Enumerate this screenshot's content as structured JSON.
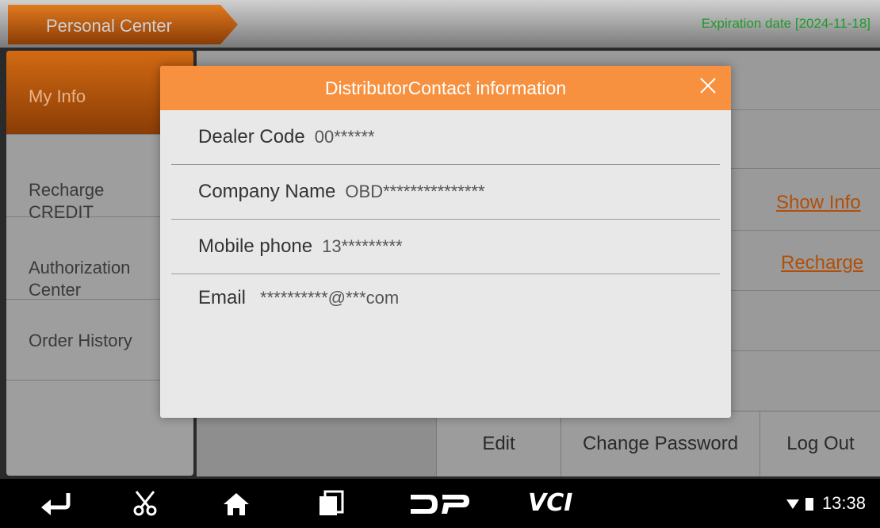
{
  "header": {
    "title": "Personal Center",
    "expiration": "Expiration date [2024-11-18]"
  },
  "sidebar": {
    "items": [
      {
        "label": "My Info",
        "active": true
      },
      {
        "label": "Recharge\nCREDIT"
      },
      {
        "label": "Authorization\nCenter"
      },
      {
        "label": "Order History"
      }
    ]
  },
  "main": {
    "show_info_link": "Show Info",
    "recharge_link": "Recharge",
    "buttons": {
      "edit": "Edit",
      "change_password": "Change Password",
      "log_out": "Log Out"
    }
  },
  "dialog": {
    "title": "DistributorContact information",
    "rows": [
      {
        "label": "Dealer Code",
        "value": "00******"
      },
      {
        "label": "Company Name",
        "value": "OBD***************"
      },
      {
        "label": "Mobile phone",
        "value": "13*********"
      },
      {
        "label": "Email",
        "value": "**********@***com"
      }
    ]
  },
  "navbar": {
    "icons": [
      "back-icon",
      "screenshot-scissors-icon",
      "home-icon",
      "recent-apps-icon",
      "dp-icon",
      "vci-icon"
    ],
    "time": "13:38"
  },
  "colors": {
    "accent": "#f7913f",
    "link": "#b24f08",
    "expire": "#1e9a2c"
  }
}
